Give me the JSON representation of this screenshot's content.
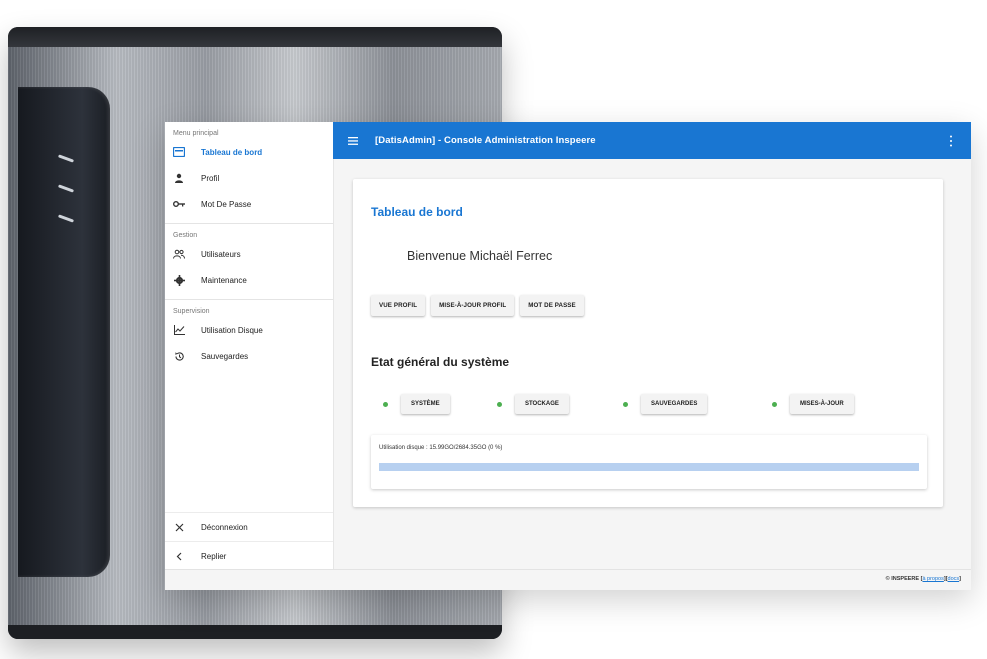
{
  "app": {
    "title": "[DatisAdmin] - Console Administration Inspeere",
    "accent_color": "#1976d2"
  },
  "sidebar": {
    "sections": [
      {
        "title": "Menu principal",
        "items": [
          {
            "label": "Tableau de bord",
            "icon": "dashboard-icon",
            "active": true
          },
          {
            "label": "Profil",
            "icon": "person-icon"
          },
          {
            "label": "Mot De Passe",
            "icon": "key-icon"
          }
        ]
      },
      {
        "title": "Gestion",
        "items": [
          {
            "label": "Utilisateurs",
            "icon": "people-icon"
          },
          {
            "label": "Maintenance",
            "icon": "gear-icon"
          }
        ]
      },
      {
        "title": "Supervision",
        "items": [
          {
            "label": "Utilisation Disque",
            "icon": "chart-icon"
          },
          {
            "label": "Sauvegardes",
            "icon": "backup-icon"
          }
        ]
      }
    ],
    "bottom": {
      "logout": {
        "label": "Déconnexion",
        "icon": "close-icon"
      },
      "collapse": {
        "label": "Replier",
        "icon": "chevron-left-icon"
      }
    }
  },
  "dashboard": {
    "title": "Tableau de bord",
    "welcome": "Bienvenue Michaël Ferrec",
    "buttons": [
      "VUE PROFIL",
      "MISE-À-JOUR PROFIL",
      "MOT DE PASSE"
    ],
    "status_heading": "Etat général du système",
    "status": [
      {
        "label": "SYSTÈME",
        "color": "#4caf50"
      },
      {
        "label": "STOCKAGE",
        "color": "#4caf50"
      },
      {
        "label": "SAUVEGARDES",
        "color": "#4caf50"
      },
      {
        "label": "MISES-À-JOUR",
        "color": "#4caf50"
      }
    ],
    "disk": {
      "text": "Utilisation disque : 15.99GO/2684.35GO (0 %)",
      "percent": 0
    }
  },
  "footer": {
    "brand": "© INSPEERE",
    "link1": "à propos",
    "link2": "docs"
  }
}
